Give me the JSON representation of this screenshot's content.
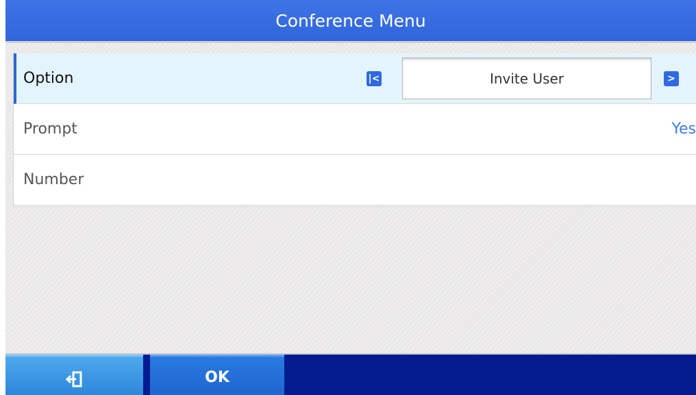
{
  "title": "Conference Menu",
  "rows": [
    {
      "label": "Option",
      "value": "Invite User",
      "selected": true
    },
    {
      "label": "Prompt",
      "value": "Yes"
    },
    {
      "label": "Number",
      "value": ""
    }
  ],
  "navigation": {
    "prev_icon": "first-icon",
    "next_icon": "next-icon"
  },
  "softkeys": {
    "exit_icon": "exit-icon",
    "ok_label": "OK"
  },
  "colors": {
    "title_bar": "#3166dc",
    "selected_row": "#e4f4fc",
    "accent": "#2b68d2",
    "value_text": "#3a7ee0",
    "softkey_bar": "#051c91",
    "softkey_exit": "#2e86db",
    "softkey_ok": "#1f66cf"
  }
}
